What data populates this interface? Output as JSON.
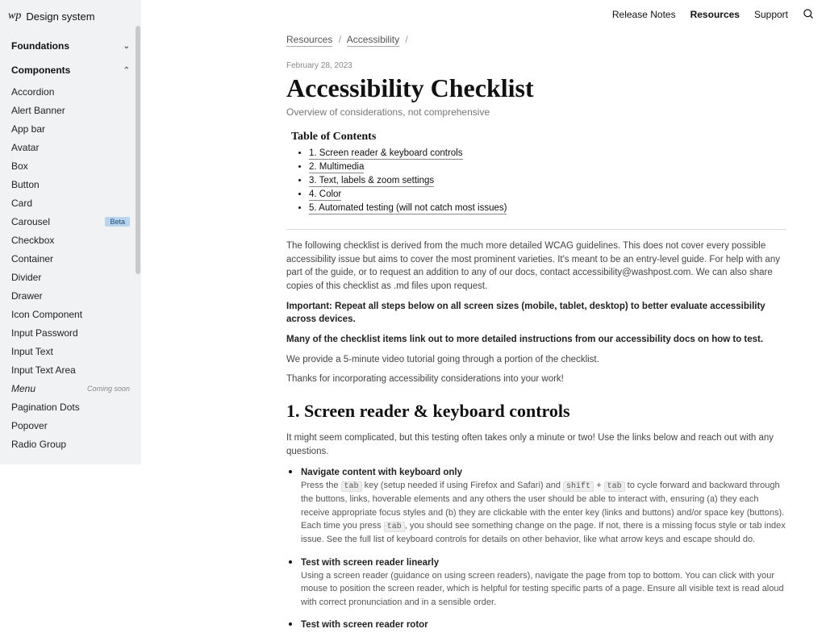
{
  "brand": {
    "icon": "wp",
    "name": "Design system"
  },
  "topnav": {
    "release_notes": "Release Notes",
    "resources": "Resources",
    "support": "Support"
  },
  "sidebar": {
    "foundations_label": "Foundations",
    "components_label": "Components",
    "items": [
      {
        "label": "Accordion"
      },
      {
        "label": "Alert Banner"
      },
      {
        "label": "App bar"
      },
      {
        "label": "Avatar"
      },
      {
        "label": "Box"
      },
      {
        "label": "Button"
      },
      {
        "label": "Card"
      },
      {
        "label": "Carousel",
        "badge": "Beta"
      },
      {
        "label": "Checkbox"
      },
      {
        "label": "Container"
      },
      {
        "label": "Divider"
      },
      {
        "label": "Drawer"
      },
      {
        "label": "Icon Component"
      },
      {
        "label": "Input Password"
      },
      {
        "label": "Input Text"
      },
      {
        "label": "Input Text Area"
      },
      {
        "label": "Menu",
        "soon": "Coming soon",
        "italic": true
      },
      {
        "label": "Pagination Dots"
      },
      {
        "label": "Popover"
      },
      {
        "label": "Radio Group"
      }
    ]
  },
  "breadcrumb": {
    "a": "Resources",
    "b": "Accessibility"
  },
  "page": {
    "date": "February 28, 2023",
    "title": "Accessibility Checklist",
    "subtitle": "Overview of considerations, not comprehensive"
  },
  "toc": {
    "heading": "Table of Contents",
    "items": [
      "1. Screen reader & keyboard controls",
      "2. Multimedia",
      "3. Text, labels & zoom settings",
      "4. Color",
      "5. Automated testing (will not catch most issues)"
    ]
  },
  "intro": {
    "p1": "The following checklist is derived from the much more detailed WCAG guidelines. This does not cover every possible accessibility issue but aims to cover the most prominent varieties. It's meant to be an entry-level guide. For help with any part of the guide, or to request an addition to any of our docs, contact accessibility@washpost.com. We can also share copies of this checklist as .md files upon request.",
    "p2": "Important: Repeat all steps below on all screen sizes (mobile, tablet, desktop) to better evaluate accessibility across devices.",
    "p3": "Many of the checklist items link out to more detailed instructions from our accessibility docs on how to test.",
    "p4": "We provide a 5-minute video tutorial going through a portion of the checklist.",
    "p5": "Thanks for incorporating accessibility considerations into your work!"
  },
  "section1": {
    "heading": "1. Screen reader & keyboard controls",
    "intro": "It might seem complicated, but this testing often takes only a minute or two! Use the links below and reach out with any questions.",
    "steps": [
      {
        "title": "Navigate content with keyboard only",
        "pre": "Press the ",
        "k1": "tab",
        "mid1": " key (setup needed if using Firefox and Safari) and ",
        "k2": "shift",
        "plus": " + ",
        "k3": "tab",
        "mid2": " to cycle forward and backward through the buttons, links, hoverable elements and any others the user should be able to interact with, ensuring (a) they each receive appropriate focus styles and (b) they are clickable with the enter key (links and buttons) and/or space key (buttons). Each time you press ",
        "k4": "tab",
        "post": ", you should see something change on the page. If not, there is a missing focus style or tab index issue. See the full list of keyboard controls for details on other behavior, like what arrow keys and escape should do."
      },
      {
        "title": "Test with screen reader linearly",
        "body": "Using a screen reader (guidance on using screen readers), navigate the page from top to bottom. You can click with your mouse to position the screen reader, which is helpful for testing specific parts of a page. Ensure all visible text is read aloud with correct pronunciation and in a sensible order."
      },
      {
        "title": "Test with screen reader rotor"
      }
    ]
  }
}
